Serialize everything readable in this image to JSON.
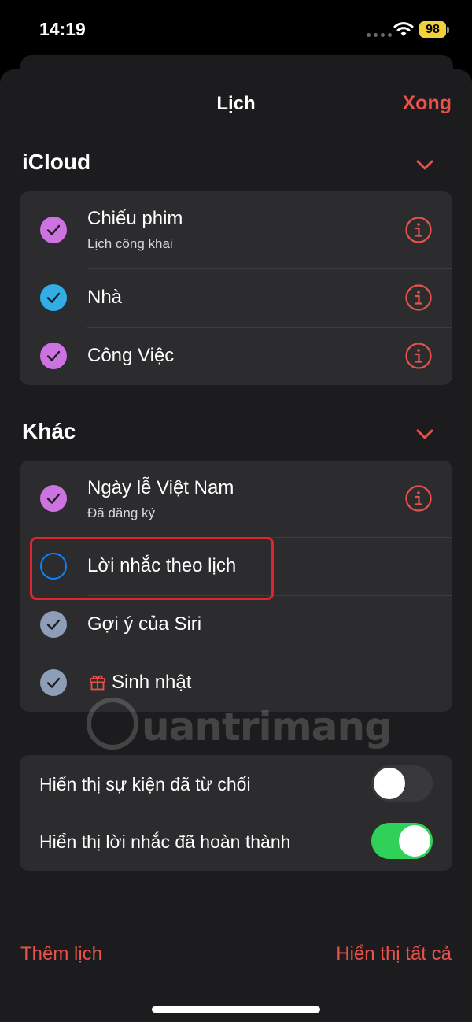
{
  "status_bar": {
    "time": "14:19",
    "battery": "98"
  },
  "nav": {
    "title": "Lịch",
    "done": "Xong"
  },
  "sections": {
    "icloud": {
      "title": "iCloud",
      "items": [
        {
          "label": "Chiếu phim",
          "sub": "Lịch công khai",
          "color": "#cc73e1",
          "checked": true
        },
        {
          "label": "Nhà",
          "color": "#32ade6",
          "checked": true
        },
        {
          "label": "Công Việc",
          "color": "#cc73e1",
          "checked": true
        }
      ]
    },
    "khac": {
      "title": "Khác",
      "items": [
        {
          "label": "Ngày lễ Việt Nam",
          "sub": "Đã đăng ký",
          "color": "#cc73e1",
          "checked": true
        },
        {
          "label": "Lời nhắc theo lịch",
          "color": "#0a84ff",
          "checked": false
        },
        {
          "label": "Gợi ý của Siri",
          "color": "#8e9db8",
          "checked": true
        },
        {
          "label": "Sinh nhật",
          "color": "#8e9db8",
          "checked": true,
          "icon": "gift-icon"
        }
      ]
    }
  },
  "toggles": [
    {
      "label": "Hiển thị sự kiện đã từ chối",
      "on": false
    },
    {
      "label": "Hiển thị lời nhắc đã hoàn thành",
      "on": true
    }
  ],
  "footer": {
    "add_calendar": "Thêm lịch",
    "show_all": "Hiển thị tất cả"
  },
  "watermark": "uantrimang",
  "colors": {
    "accent": "#e9524a",
    "toggle_on": "#30d158",
    "toggle_off": "#39393d"
  }
}
